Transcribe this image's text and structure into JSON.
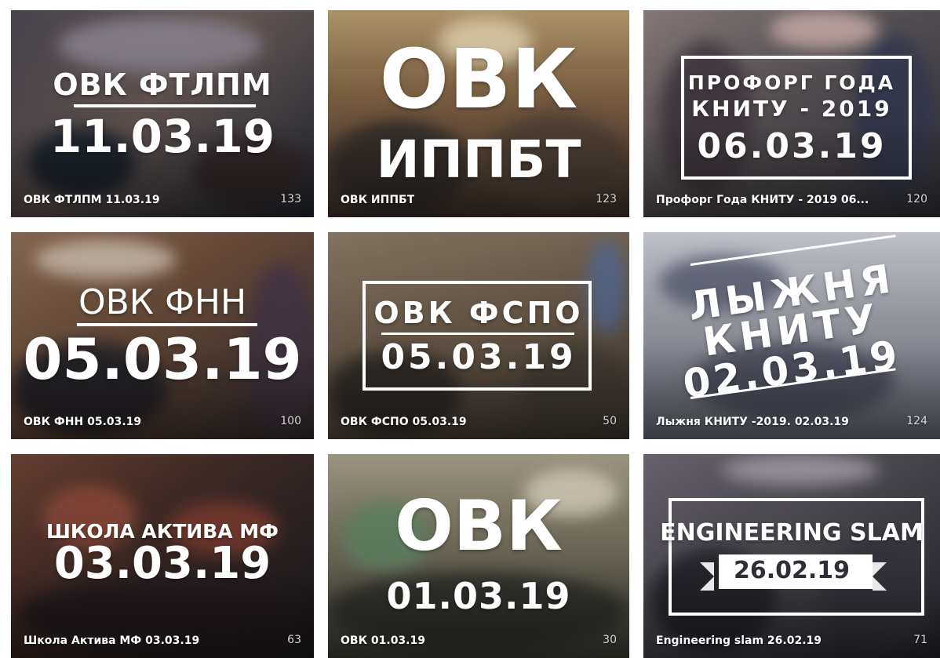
{
  "albums": [
    {
      "caption": "ОВК ФТЛПМ 11.03.19",
      "count": "133",
      "cover_lines": [
        "ОВК ФТЛПМ",
        "11.03.19"
      ],
      "colors": [
        "#3d3a44",
        "#6b5c58",
        "#2a2f3b"
      ]
    },
    {
      "caption": "ОВК ИППБТ",
      "count": "123",
      "cover_lines": [
        "ОВК",
        "ИППБТ"
      ],
      "colors": [
        "#8a6a48",
        "#5b4a3e",
        "#b49a6c"
      ]
    },
    {
      "caption": "Профорг Года КНИТУ - 2019 06...",
      "count": "120",
      "cover_lines": [
        "ПРОФОРГ ГОДА",
        "КНИТУ - 2019",
        "06.03.19"
      ],
      "colors": [
        "#5a5459",
        "#8c7f7d",
        "#3c3a42"
      ]
    },
    {
      "caption": "ОВК ФНН 05.03.19",
      "count": "100",
      "cover_lines": [
        "ОВК ФНН",
        "05.03.19"
      ],
      "colors": [
        "#6d4e3c",
        "#3b3436",
        "#8a6a52"
      ]
    },
    {
      "caption": "ОВК ФСПО 05.03.19",
      "count": "50",
      "cover_lines": [
        "ОВК ФСПО",
        "05.03.19"
      ],
      "colors": [
        "#6d5d4d",
        "#4a4139",
        "#8a7a66"
      ]
    },
    {
      "caption": "Лыжня КНИТУ -2019. 02.03.19",
      "count": "124",
      "cover_lines": [
        "ЛЫЖНЯ",
        "КНИТУ",
        "02.03.19"
      ],
      "colors": [
        "#a4a7b0",
        "#7c8090",
        "#c8cbd3"
      ]
    },
    {
      "caption": "Школа Актива МФ 03.03.19",
      "count": "63",
      "cover_lines": [
        "ШКОЛА АКТИВА МФ",
        "03.03.19"
      ],
      "colors": [
        "#3b2a26",
        "#6b4034",
        "#1f1d22"
      ]
    },
    {
      "caption": "ОВК 01.03.19",
      "count": "30",
      "cover_lines": [
        "ОВК",
        "01.03.19"
      ],
      "colors": [
        "#7b7563",
        "#4a4a40",
        "#a39b86"
      ]
    },
    {
      "caption": "Engineering slam 26.02.19",
      "count": "71",
      "cover_lines": [
        "ENGINEERING SLAM",
        "26.02.19"
      ],
      "colors": [
        "#4e4b53",
        "#2f2e36",
        "#6c6672"
      ]
    }
  ]
}
